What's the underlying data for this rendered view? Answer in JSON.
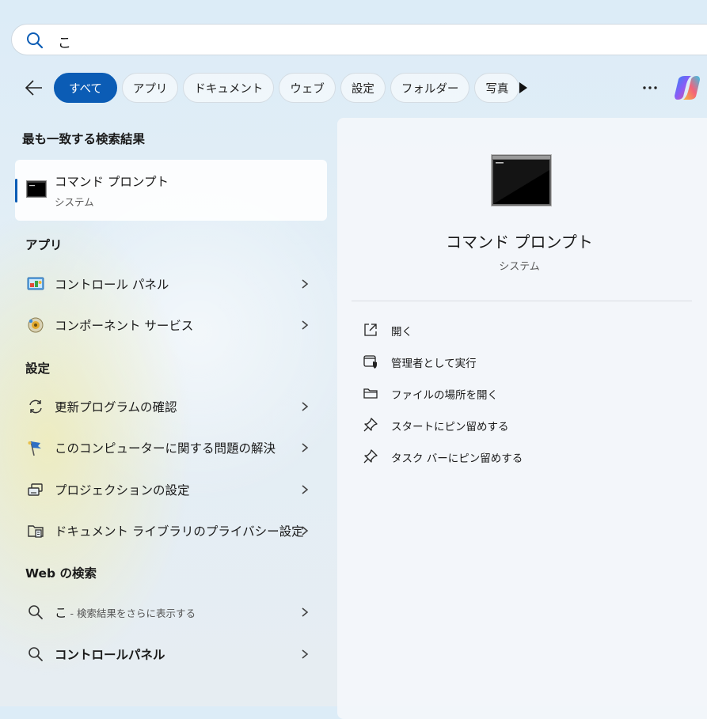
{
  "search": {
    "value": "こ"
  },
  "filters": [
    "すべて",
    "アプリ",
    "ドキュメント",
    "ウェブ",
    "設定",
    "フォルダー",
    "写真"
  ],
  "sections": {
    "best_match": "最も一致する検索結果",
    "apps": "アプリ",
    "settings": "設定",
    "web": "Web の検索"
  },
  "best_match": {
    "name": "コマンド プロンプト",
    "sub": "システム"
  },
  "apps": [
    {
      "label": "コントロール パネル",
      "icon": "control-panel-icon"
    },
    {
      "label": "コンポーネント サービス",
      "icon": "component-services-icon"
    }
  ],
  "settings": [
    {
      "label": "更新プログラムの確認",
      "icon": "sync-icon"
    },
    {
      "label": "このコンピューターに関する問題の解決",
      "icon": "troubleshoot-flag-icon"
    },
    {
      "label": "プロジェクションの設定",
      "icon": "projection-icon"
    },
    {
      "label": "ドキュメント ライブラリのプライバシー設定",
      "icon": "document-library-icon"
    }
  ],
  "web": [
    {
      "query": "こ",
      "hint": " - 検索結果をさらに表示する"
    },
    {
      "query": "コントロールパネル"
    }
  ],
  "preview": {
    "title": "コマンド プロンプト",
    "sub": "システム",
    "actions": [
      "開く",
      "管理者として実行",
      "ファイルの場所を開く",
      "スタートにピン留めする",
      "タスク バーにピン留めする"
    ]
  },
  "colors": {
    "accent": "#0b5cb5"
  }
}
